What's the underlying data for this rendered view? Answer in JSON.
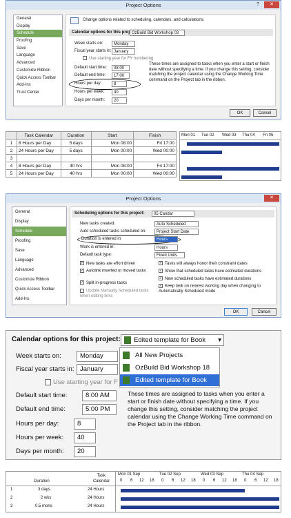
{
  "dialog1": {
    "title": "Project Options",
    "help": "?",
    "close": "✕",
    "header": "Change options related to scheduling, calendars, and calculations.",
    "sidebar": [
      "General",
      "Display",
      "Schedule",
      "Proofing",
      "Save",
      "Language",
      "Advanced",
      "Customize Ribbon",
      "Quick Access Toolbar",
      "Add-Ins",
      "Trust Center"
    ],
    "cal_label": "Calendar options for this project:",
    "cal_value": "OzBuild Bid Workshop 03",
    "week_label": "Week starts on:",
    "week_value": "Monday",
    "fiscal_label": "Fiscal year starts in:",
    "fiscal_value": "January",
    "use_fy": "Use starting year for FY numbering",
    "start_time_label": "Default start time:",
    "start_time_value": "08:00",
    "end_time_label": "Default end time:",
    "end_time_value": "17:00",
    "hours_day_label": "Hours per day:",
    "hours_day_value": "8",
    "hours_week_label": "Hours per week:",
    "hours_week_value": "40",
    "days_month_label": "Days per month:",
    "days_month_value": "20",
    "note": "These times are assigned to tasks when you enter a start or finish date without specifying a time. If you change this setting, consider matching the project calendar using the Change Working Time command on the Project tab in the ribbon.",
    "ok": "OK",
    "cancel": "Cancel"
  },
  "grid1": {
    "headers": [
      "",
      "Task Calendar",
      "Duration",
      "Start",
      "Finish"
    ],
    "days": [
      "Mon 01",
      "Tue 02",
      "Wed 03",
      "Thu 04",
      "Fri 05"
    ],
    "rows": [
      {
        "n": "1",
        "cal": "8 Hours per Day",
        "dur": "5 days",
        "start": "Mon 08:00",
        "finish": "Fri 17:00"
      },
      {
        "n": "2",
        "cal": "24 Hours per Day",
        "dur": "5 days",
        "start": "Mon 00:00",
        "finish": "Wed 00:00"
      },
      {
        "n": "3",
        "cal": "",
        "dur": "",
        "start": "",
        "finish": ""
      },
      {
        "n": "4",
        "cal": "8 Hours per Day",
        "dur": "40 hrs",
        "start": "Mon 08:00",
        "finish": "Fri 17:00"
      },
      {
        "n": "5",
        "cal": "24 Hours per Day",
        "dur": "40 hrs",
        "start": "Mon 00:00",
        "finish": "Wed 00:00"
      }
    ]
  },
  "dialog2": {
    "title": "Project Options",
    "sidebar": [
      "General",
      "Display",
      "Schedule",
      "Proofing",
      "Save",
      "Language",
      "Advanced",
      "Customize Ribbon",
      "Quick Access Toolbar",
      "Add-Ins"
    ],
    "sched_label": "Scheduling options for this project:",
    "sched_value": "05 Candar",
    "new_tasks_label": "New tasks created:",
    "new_tasks_value": "Auto Scheduled",
    "auto_on_label": "Auto scheduled tasks scheduled on:",
    "auto_on_value": "Project Start Date",
    "duration_label": "Duration is entered in:",
    "duration_value": "Hours",
    "work_label": "Work is entered in:",
    "work_value": "Hours",
    "task_type_label": "Default task type:",
    "task_type_value": "Fixed Units",
    "checks_left": [
      "New tasks are effort driven",
      "Autolink inserted or moved tasks",
      "Split in-progress tasks",
      "Update Manually Scheduled tasks when editing links"
    ],
    "checks_right": [
      "Tasks will always honor their constraint dates",
      "Show that scheduled tasks have estimated durations",
      "New scheduled tasks have estimated durations",
      "Keep task on nearest working day when changing to Automatically Scheduled mode"
    ],
    "ok": "OK",
    "cancel": "Cancel"
  },
  "zoom": {
    "cal_label": "Calendar options for this project:",
    "cal_value": "Edited template for Book",
    "dropdown": [
      "All New Projects",
      "OzBuild Bid Workshop 18",
      "Edited template for Book"
    ],
    "week_label": "Week starts on:",
    "week_value": "Monday",
    "fiscal_label": "Fiscal year starts in:",
    "fiscal_value": "January",
    "use_fy": "Use starting year for F",
    "start_label": "Default start time:",
    "start_value": "8:00 AM",
    "end_label": "Default end time:",
    "end_value": "5:00 PM",
    "hpd_label": "Hours per day:",
    "hpd_value": "8",
    "hpw_label": "Hours per week:",
    "hpw_value": "40",
    "dpm_label": "Days per month:",
    "dpm_value": "20",
    "note": "These times are assigned to tasks when you enter a start or finish date without specifying a time. If you change this setting, consider matching the project calendar using the Change Working Time command on the Project tab in the ribbon."
  },
  "grid2": {
    "h_duration": "Duration",
    "h_calendar": "Task Calendar",
    "days": [
      "Mon 01 Sep",
      "Tue 02 Sep",
      "Wed 03 Sep",
      "Thu 04 Sep"
    ],
    "hours": [
      "0",
      "6",
      "12",
      "18"
    ],
    "rows": [
      {
        "n": "1",
        "dur": "3 days",
        "cal": "24 Hours"
      },
      {
        "n": "2",
        "dur": "2 wks",
        "cal": "24 Hours"
      },
      {
        "n": "3",
        "dur": "0.5 mons",
        "cal": "24 Hours"
      }
    ]
  }
}
